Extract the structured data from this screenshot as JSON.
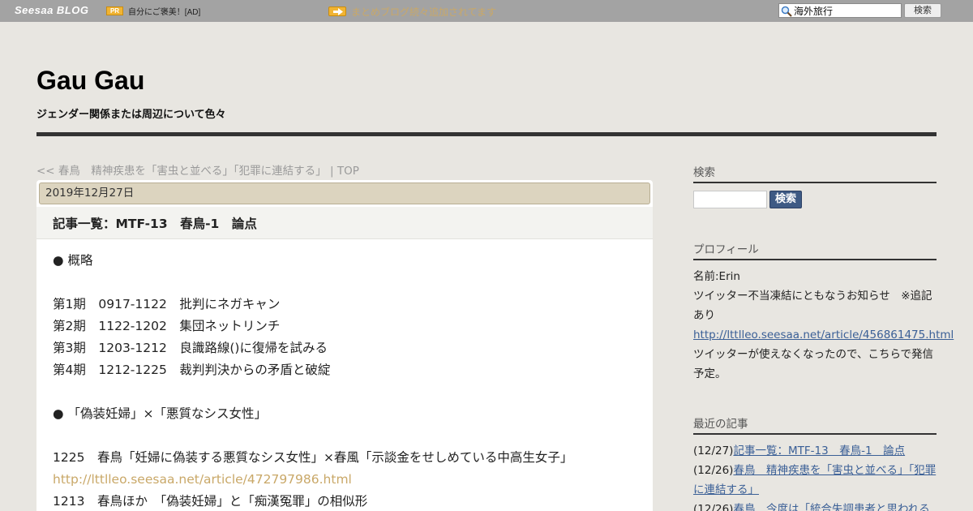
{
  "topbar": {
    "logo": "Seesaa BLOG",
    "pr_badge": "PR",
    "pr_text": "自分にご褒美！[AD]",
    "notice": "まとめブログ続々追加されてます",
    "search_value": "海外旅行",
    "search_button": "検索"
  },
  "header": {
    "title": "Gau Gau",
    "subtitle": "ジェンダー関係または周辺について色々"
  },
  "nav": {
    "prev_link": "<< 春鳥　精神疾患を「害虫と並べる」「犯罪に連結する」",
    "separator": "|",
    "top_link": "TOP"
  },
  "article": {
    "date": "2019年12月27日",
    "title": "記事一覧：MTF-13　春鳥-1　論点",
    "lines": [
      "● 概略",
      "",
      "第1期　0917-1122　批判にネガキャン",
      "第2期　1122-1202　集団ネットリンチ",
      "第3期　1203-1212　良識路線()に復帰を試みる",
      "第4期　1212-1225　裁判判決からの矛盾と破綻",
      "",
      "● 「偽装妊婦」×「悪質なシス女性」",
      "",
      "1225　春鳥「妊婦に偽装する悪質なシス女性」×春風「示談金をせしめている中高生女子」",
      "http://lttlleo.seesaa.net/article/472797986.html",
      "1213　春鳥ほか　「偽装妊婦」と「痴漢冤罪」の相似形"
    ]
  },
  "sidebar": {
    "search_heading": "検索",
    "search_button": "検索",
    "profile_heading": "プロフィール",
    "profile_name": "名前:Erin",
    "profile_text1": "ツイッター不当凍結にともなうお知らせ　※追記あり",
    "profile_link": "http://lttlleo.seesaa.net/article/456861475.html",
    "profile_text2": "ツイッターが使えなくなったので、こちらで発信予定。",
    "recent_heading": "最近の記事",
    "recent": [
      {
        "date": "(12/27)",
        "title": "記事一覧：MTF-13　春鳥-1　論点"
      },
      {
        "date": "(12/26)",
        "title": "春鳥　精神疾患を「害虫と並べる」「犯罪に連結する」"
      },
      {
        "date": "(12/26)",
        "title": "春鳥　今度は「統合失調患者と思われる"
      }
    ]
  },
  "colors": {
    "topbar_bg": "#a3a3a3",
    "page_bg": "#e8e6e1",
    "link_gold": "#c9a868",
    "link_blue": "#3a5f96",
    "date_bar": "#dcd4bf"
  }
}
